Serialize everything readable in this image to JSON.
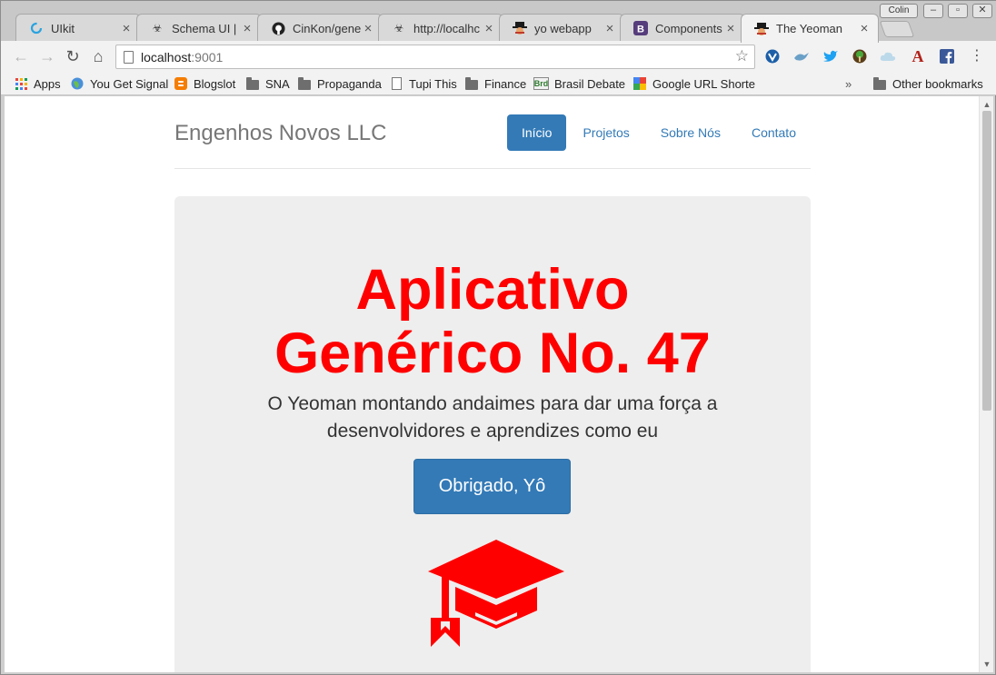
{
  "browser": {
    "profile_name": "Colin",
    "tabs": [
      {
        "title": "UIkit",
        "icon": "uikit-icon",
        "active": false
      },
      {
        "title": "Schema UI |",
        "icon": "biohazard-icon",
        "active": false
      },
      {
        "title": "CinKon/gene",
        "icon": "github-icon",
        "active": false
      },
      {
        "title": "http://localhc",
        "icon": "biohazard-icon",
        "active": false
      },
      {
        "title": "yo webapp",
        "icon": "yeoman-icon",
        "active": false
      },
      {
        "title": "Components",
        "icon": "bootstrap-icon",
        "active": false
      },
      {
        "title": "The Yeoman",
        "icon": "yeoman-icon",
        "active": true
      }
    ],
    "url_host": "localhost",
    "url_port": ":9001",
    "bookmarks": [
      {
        "label": "Apps",
        "icon": "apps-grid-icon"
      },
      {
        "label": "You Get Signal",
        "icon": "globe-icon"
      },
      {
        "label": "Blogslot",
        "icon": "blogger-icon"
      },
      {
        "label": "SNA",
        "icon": "folder-icon"
      },
      {
        "label": "Propaganda",
        "icon": "folder-icon"
      },
      {
        "label": "Tupi This",
        "icon": "document-icon"
      },
      {
        "label": "Finance",
        "icon": "folder-icon"
      },
      {
        "label": "Brasil Debate",
        "icon": "brd-icon"
      },
      {
        "label": "Google URL Shortene",
        "icon": "google-icon"
      }
    ],
    "overflow_label": "»",
    "other_bookmarks": "Other bookmarks"
  },
  "page": {
    "brand": "Engenhos Novos LLC",
    "nav": [
      {
        "label": "Início",
        "active": true
      },
      {
        "label": "Projetos",
        "active": false
      },
      {
        "label": "Sobre Nós",
        "active": false
      },
      {
        "label": "Contato",
        "active": false
      }
    ],
    "hero": {
      "title_line1": "Aplicativo",
      "title_line2": "Genérico No. 47",
      "lead": "O Yeoman montando andaimes para dar uma força a desenvolvidores e aprendizes como eu",
      "button_label": "Obrigado, Yô",
      "title_color": "#ff0000",
      "icon": "graduation-cap-icon"
    }
  },
  "colors": {
    "accent": "#337ab7",
    "hero_red": "#ff0000",
    "jumbotron_bg": "#eeeeee"
  }
}
